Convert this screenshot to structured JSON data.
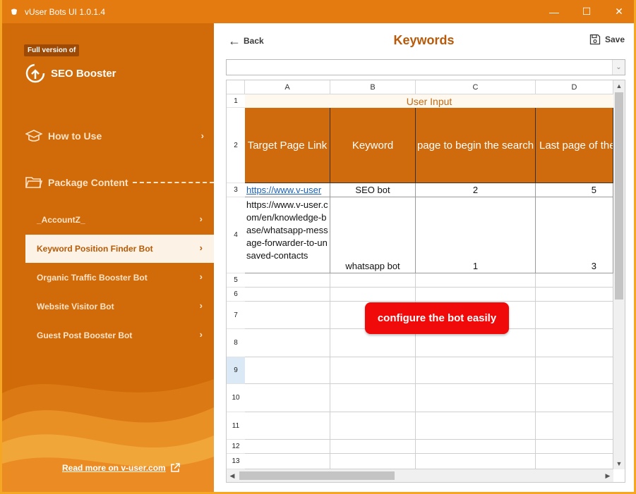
{
  "window": {
    "title": "vUser Bots UI 1.0.1.4",
    "controls": {
      "minimize": "—",
      "maximize": "☐",
      "close": "✕"
    },
    "accent": "#e37b10"
  },
  "sidebar": {
    "badge": "Full version of",
    "brand": "SEO Booster",
    "how_to_use": "How to Use",
    "package_content": "Package Content",
    "items": [
      {
        "label": "_AccountZ_"
      },
      {
        "label": "Keyword Position Finder Bot",
        "active": true
      },
      {
        "label": "Organic Traffic Booster Bot"
      },
      {
        "label": "Website Visitor Bot"
      },
      {
        "label": "Guest Post Booster Bot"
      }
    ],
    "read_more": "Read more on v-user.com",
    "chevron": "›"
  },
  "toolbar": {
    "back_label": "Back",
    "title": "Keywords",
    "save_label": "Save"
  },
  "sheet": {
    "columns": [
      "A",
      "B",
      "C",
      "D"
    ],
    "rows": [
      "1",
      "2",
      "3",
      "4",
      "5",
      "6",
      "7",
      "8",
      "9",
      "10",
      "11",
      "12",
      "13"
    ],
    "selected_row": "9",
    "merged_title": "User Input",
    "headers": [
      "Target Page Link",
      "Keyword",
      "page to begin the search",
      "Last page of the"
    ],
    "data": [
      [
        "https://www.v-user",
        "SEO bot",
        "2",
        "5"
      ],
      [
        "https://www.v-user.com/en/knowledge-base/whatsapp-message-forwarder-to-unsaved-contacts",
        "whatsapp bot",
        "1",
        "3"
      ]
    ]
  },
  "callout": "configure the bot easily"
}
